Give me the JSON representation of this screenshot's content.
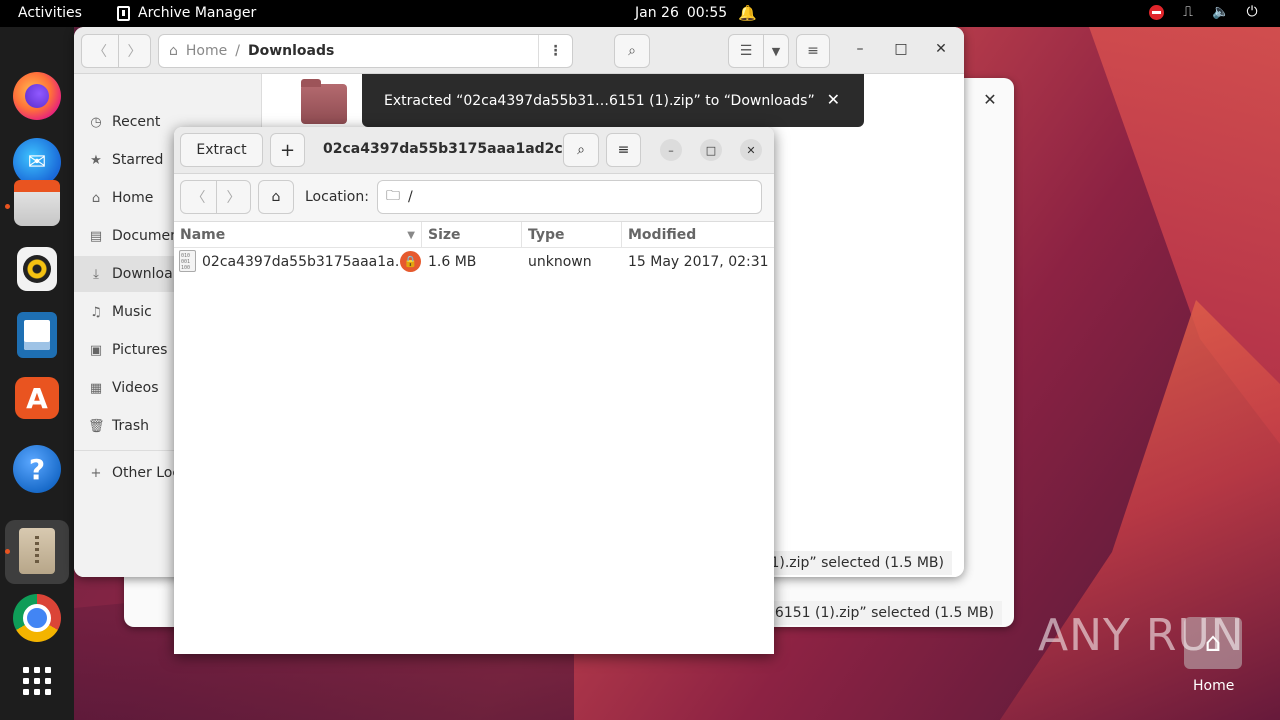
{
  "topbar": {
    "activities": "Activities",
    "app_name": "Archive Manager",
    "date": "Jan 26",
    "time": "00:55"
  },
  "dock": {
    "items": [
      "firefox-icon",
      "thunderbird-icon",
      "files-icon",
      "rhythmbox-icon",
      "writer-icon",
      "app-center-icon",
      "help-icon",
      "archive-manager-icon",
      "chrome-icon",
      "show-apps-icon"
    ]
  },
  "nautilus": {
    "breadcrumb_home": "Home",
    "breadcrumb_sep": "/",
    "breadcrumb_current": "Downloads",
    "sidebar": [
      {
        "label": "Recent",
        "icon": "clock-icon"
      },
      {
        "label": "Starred",
        "icon": "star-icon"
      },
      {
        "label": "Home",
        "icon": "home-icon"
      },
      {
        "label": "Documen",
        "icon": "document-icon"
      },
      {
        "label": "Downloa",
        "icon": "download-icon"
      },
      {
        "label": "Music",
        "icon": "music-icon"
      },
      {
        "label": "Pictures",
        "icon": "picture-icon"
      },
      {
        "label": "Videos",
        "icon": "video-icon"
      },
      {
        "label": "Trash",
        "icon": "trash-icon"
      },
      {
        "label": "Other Loc",
        "icon": "plus-icon"
      }
    ],
    "status": "1 (1).zip” selected  (1.5 MB)"
  },
  "back_window": {
    "status": "2f66151 (1).zip” selected  (1.5 MB)"
  },
  "toast": {
    "message": "Extracted “02ca4397da55b31…6151 (1).zip” to “Downloads”"
  },
  "archive": {
    "extract_label": "Extract",
    "title": "02ca4397da55b3175aaa1ad2c…",
    "location_label": "Location:",
    "location_value": "/",
    "columns": {
      "name": "Name",
      "size": "Size",
      "type": "Type",
      "modified": "Modified"
    },
    "rows": [
      {
        "name": "02ca4397da55b3175aaa1a…",
        "size": "1.6 MB",
        "type": "unknown",
        "modified": "15 May 2017, 02:31",
        "encrypted": true
      }
    ]
  },
  "desktop": {
    "home_label": "Home",
    "watermark": "ANY RUN"
  },
  "colors": {
    "accent": "#e95420",
    "lock_badge": "#e65a2e"
  }
}
